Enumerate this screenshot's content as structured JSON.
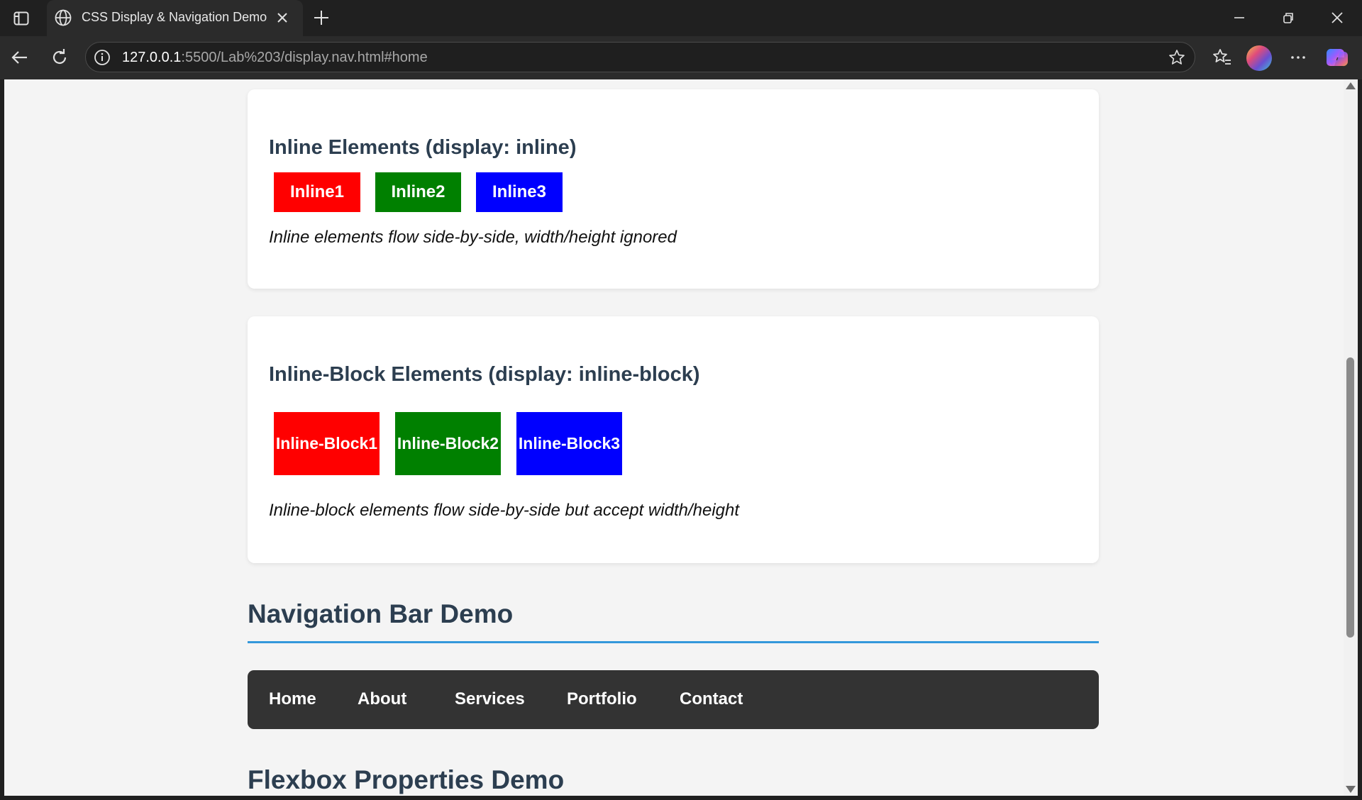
{
  "browser": {
    "tab_title": "CSS Display & Navigation Demo",
    "url_host": "127.0.0.1",
    "url_rest": ":5500/Lab%203/display.nav.html#home"
  },
  "inline_section": {
    "heading": "Inline Elements (display: inline)",
    "items": [
      {
        "label": "Inline1",
        "color": "#ff0000"
      },
      {
        "label": "Inline2",
        "color": "#008000"
      },
      {
        "label": "Inline3",
        "color": "#0000ff"
      }
    ],
    "note": "Inline elements flow side-by-side, width/height ignored"
  },
  "inline_block_section": {
    "heading": "Inline-Block Elements (display: inline-block)",
    "items": [
      {
        "label": "Inline-Block1",
        "color": "#ff0000"
      },
      {
        "label": "Inline-Block2",
        "color": "#008000"
      },
      {
        "label": "Inline-Block3",
        "color": "#0000ff"
      }
    ],
    "note": "Inline-block elements flow side-by-side but accept width/height"
  },
  "nav_demo": {
    "heading": "Navigation Bar Demo",
    "links": [
      "Home",
      "About",
      "Services",
      "Portfolio",
      "Contact"
    ],
    "bar_color": "#333333",
    "rule_color": "#3498db"
  },
  "flexbox_demo": {
    "heading": "Flexbox Properties Demo"
  }
}
